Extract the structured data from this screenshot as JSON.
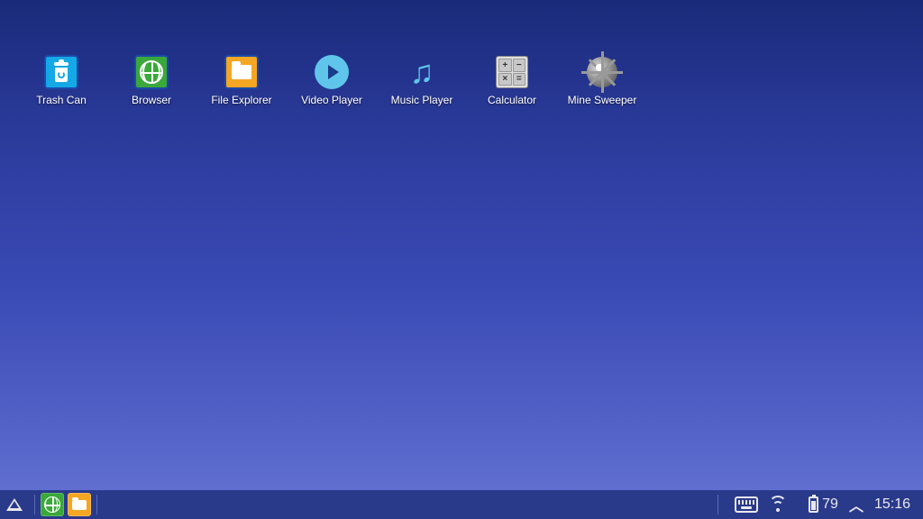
{
  "desktop": {
    "icons": [
      {
        "label": "Trash Can"
      },
      {
        "label": "Browser"
      },
      {
        "label": "File Explorer"
      },
      {
        "label": "Video Player"
      },
      {
        "label": "Music Player"
      },
      {
        "label": "Calculator"
      },
      {
        "label": "Mine Sweeper"
      }
    ]
  },
  "taskbar": {
    "battery_level": "79",
    "clock": "15:16"
  }
}
